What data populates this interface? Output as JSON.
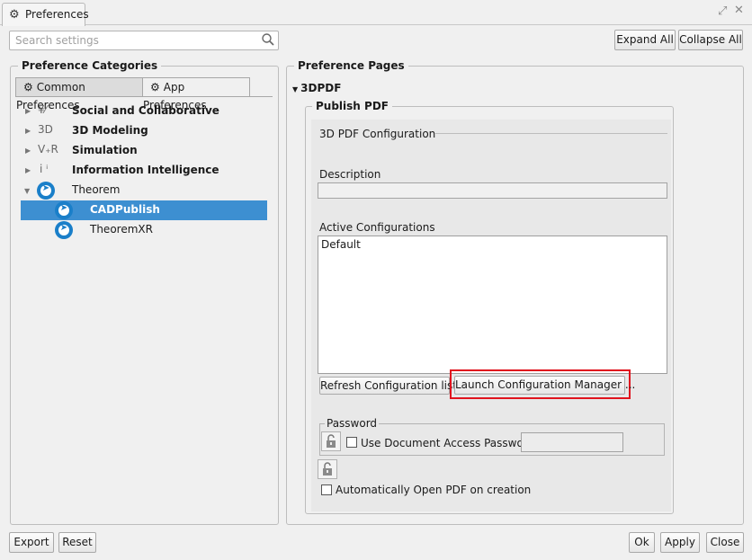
{
  "window": {
    "title": "Preferences",
    "icons": [
      "gear-icon",
      "expand-icon",
      "close-icon"
    ]
  },
  "search": {
    "placeholder": "Search settings",
    "value": ""
  },
  "toolbar": {
    "expand_all": "Expand All",
    "collapse_all": "Collapse All"
  },
  "categories": {
    "title": "Preference Categories",
    "tabs": [
      {
        "label": "Common Preferences",
        "active": false
      },
      {
        "label": "App Preferences",
        "active": true
      }
    ],
    "tree": [
      {
        "label": "Social and Collaborative",
        "icon": "social-icon",
        "icon_text": "¥⁄",
        "bold": true,
        "expanded": false
      },
      {
        "label": "3D Modeling",
        "icon": "3d-modeling-icon",
        "icon_text": "3D",
        "bold": true,
        "expanded": false
      },
      {
        "label": "Simulation",
        "icon": "simulation-icon",
        "icon_text": "V₊R",
        "bold": true,
        "expanded": false
      },
      {
        "label": "Information Intelligence",
        "icon": "info-intelligence-icon",
        "icon_text": "i ⁱ",
        "bold": true,
        "expanded": false
      },
      {
        "label": "Theorem",
        "icon": "theorem-icon",
        "bold": false,
        "expanded": true,
        "children": [
          {
            "label": "CADPublish",
            "icon": "cadpublish-icon",
            "selected": true
          },
          {
            "label": "TheoremXR",
            "icon": "theoremxr-icon",
            "selected": false
          }
        ]
      }
    ]
  },
  "pages": {
    "title": "Preference Pages",
    "section": "3DPDF",
    "group": "Publish PDF",
    "config_title": "3D PDF Configuration",
    "description_label": "Description",
    "description_value": "",
    "active_configs_label": "Active Configurations",
    "active_configs": [
      "Default"
    ],
    "refresh_button": "Refresh Configuration list",
    "launch_button": "Launch Configuration Manager ...",
    "password": {
      "title": "Password",
      "use_password_label": "Use Document Access Password",
      "use_password_checked": false,
      "password_value": ""
    },
    "auto_open_label": "Automatically Open PDF on creation",
    "auto_open_checked": false
  },
  "footer": {
    "export": "Export",
    "reset": "Reset",
    "ok": "Ok",
    "apply": "Apply",
    "close": "Close"
  },
  "colors": {
    "selection": "#3d8fd1",
    "theorem_blue": "#1a7fc9",
    "highlight_border": "#e0141e"
  }
}
